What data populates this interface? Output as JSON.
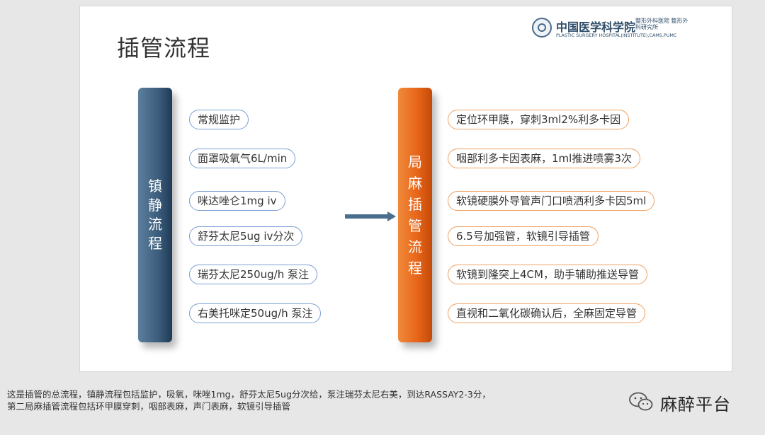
{
  "slide": {
    "title": "插管流程",
    "logo": {
      "name_cn": "中国医学科学院",
      "name_cn_sub": "整形外科医院 整形外科研究所",
      "name_en": "PLASTIC SURGERY HOSPITAL(INSTITUTE),CAMS,PUMC"
    },
    "sedation": {
      "label": "镇静流程",
      "steps": [
        "常规监护",
        "面罩吸氧气6L/min",
        "咪达唑仑1mg iv",
        "舒芬太尼5ug iv分次",
        "瑞芬太尼250ug/h 泵注",
        "右美托咪定50ug/h 泵注"
      ]
    },
    "intubation": {
      "label": "局麻插管流程",
      "steps": [
        "定位环甲膜，穿刺3ml2%利多卡因",
        "咽部利多卡因表麻，1ml推进喷雾3次",
        "软镜硬膜外导管声门口喷洒利多卡因5ml",
        "6.5号加强管，软镜引导插管",
        "软镜到隆突上4CM，助手辅助推送导管",
        "直视和二氧化碳确认后，全麻固定导管"
      ]
    }
  },
  "notes": {
    "line1": "这是插管的总流程，镇静流程包括监护，吸氧，咪唑1mg，舒芬太尼5ug分次给，泵注瑞芬太尼右美，到达RASSAY2-3分，",
    "line2": "第二局麻插管流程包括环甲膜穿刺，咽部表麻，声门表麻，软镜引导插管"
  },
  "watermark": {
    "label": "麻醉平台",
    "icon": "wechat-icon"
  },
  "colors": {
    "sedation_pillar": "#3b5d7b",
    "intubation_pillar": "#e8661a",
    "sedation_border": "#7b9fd4",
    "intubation_border": "#f0a060",
    "arrow": "#4a6f8e"
  }
}
